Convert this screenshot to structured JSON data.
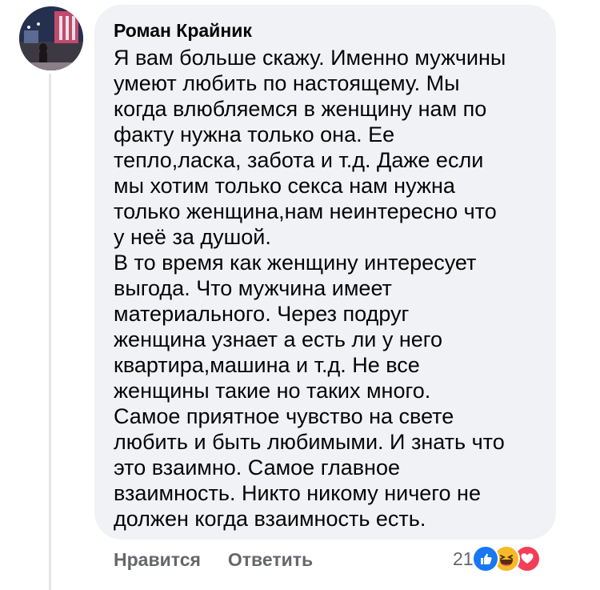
{
  "comment": {
    "author": "Роман Крайник",
    "lines": [
      "Я вам больше скажу. Именно мужчины",
      "умеют любить по настоящему. Мы",
      "когда влюбляемся в женщину нам по",
      "факту нужна только она. Ее",
      "тепло,ласка, забота и т.д. Даже если",
      "мы хотим только секса нам нужна",
      "только женщина,нам неинтересно что",
      "у неё за душой.",
      "В то время как женщину интересует",
      "выгода. Что мужчина имеет",
      "материального. Через подруг",
      "женщина узнает а есть ли у него",
      "квартира,машина и т.д. Не все",
      "женщины такие но таких много.",
      "Самое приятное чувство на свете",
      "любить и быть любимыми. И знать что",
      "это взаимно. Самое главное",
      "взаимность. Никто никому ничего не",
      "должен когда взаимность есть."
    ]
  },
  "actions": {
    "like_label": "Нравится",
    "reply_label": "Ответить"
  },
  "reactions": {
    "count": "21",
    "types": [
      "like-icon",
      "haha-icon",
      "love-icon"
    ],
    "colors": {
      "like": "#1877f2",
      "haha": "#f7b928",
      "love": "#f33e58"
    }
  }
}
